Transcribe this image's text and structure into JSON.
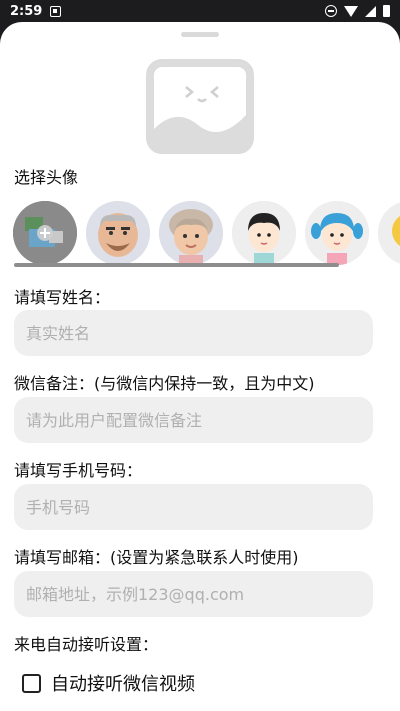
{
  "status_bar": {
    "time": "2:59"
  },
  "form": {
    "avatar_label": "选择头像",
    "name_label": "请填写姓名：",
    "name_placeholder": "真实姓名",
    "wechat_label": "微信备注：(与微信内保持一致，且为中文)",
    "wechat_placeholder": "请为此用户配置微信备注",
    "phone_label": "请填写手机号码：",
    "phone_placeholder": "手机号码",
    "email_label": "请填写邮箱：(设置为紧急联系人时使用)",
    "email_placeholder": "邮箱地址，示例123@qq.com",
    "autoanswer_label": "来电自动接听设置：",
    "autoanswer_checkbox_label": "自动接听微信视频",
    "autoanswer_checked": false
  },
  "avatars": [
    {
      "name": "add-photo"
    },
    {
      "name": "grandpa"
    },
    {
      "name": "grandma"
    },
    {
      "name": "boy"
    },
    {
      "name": "girl"
    },
    {
      "name": "more"
    }
  ],
  "colors": {
    "sheet_bg": "#ffffff",
    "input_bg": "#efefef",
    "placeholder_text": "#b0b0b0",
    "status_bar_bg": "#1c1c1e"
  }
}
